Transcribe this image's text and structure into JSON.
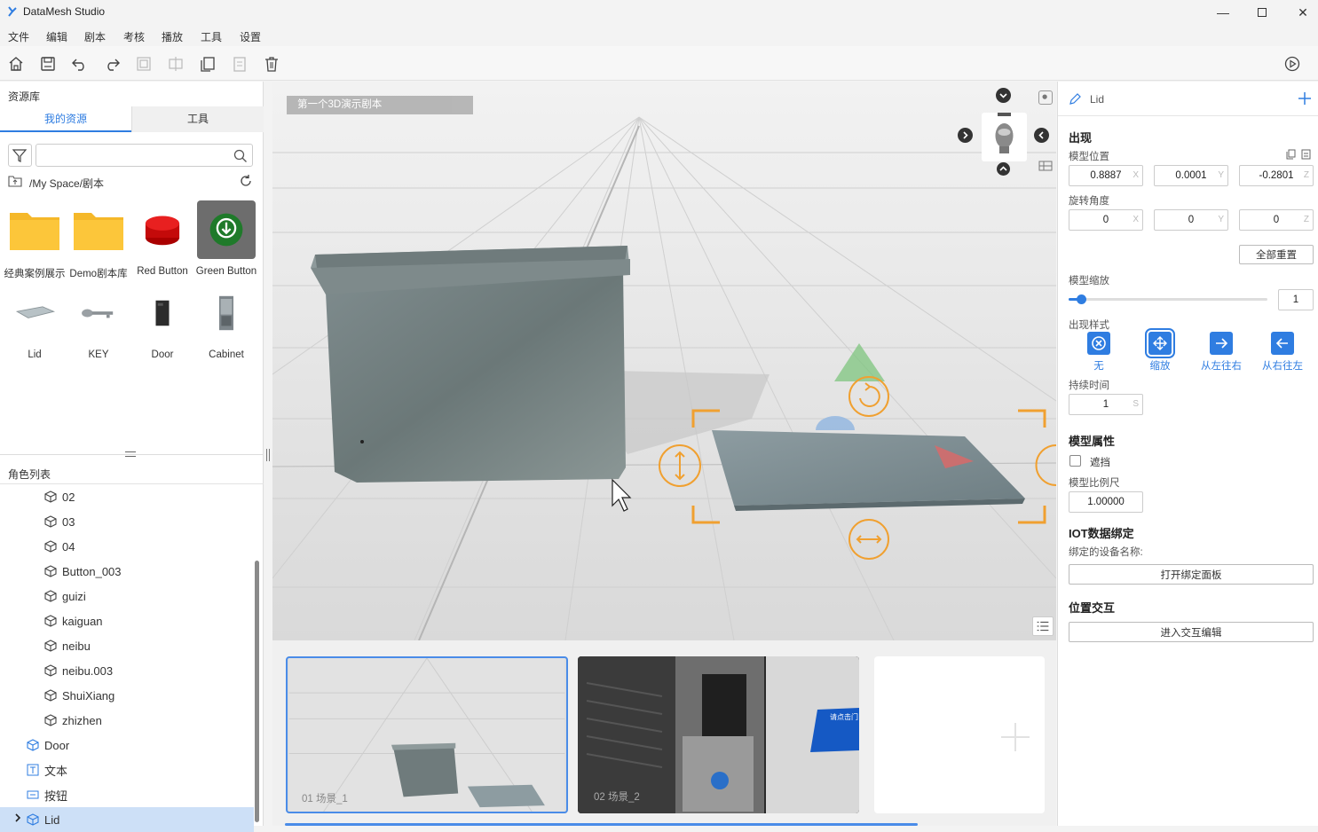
{
  "window": {
    "title": "DataMesh Studio"
  },
  "menu": [
    "文件",
    "编辑",
    "剧本",
    "考核",
    "播放",
    "工具",
    "设置"
  ],
  "left": {
    "library_title": "资源库",
    "tabs": [
      "我的资源",
      "工具"
    ],
    "path": "/My Space/剧本",
    "assets": [
      {
        "label": "经典案例展示",
        "icon": "folder-icon"
      },
      {
        "label": "Demo剧本库",
        "icon": "folder-icon"
      },
      {
        "label": "Red Button",
        "icon": "red-button-icon"
      },
      {
        "label": "Green Button",
        "icon": "green-button-icon"
      },
      {
        "label": "Lid",
        "icon": "lid-icon"
      },
      {
        "label": "KEY",
        "icon": "key-icon"
      },
      {
        "label": "Door",
        "icon": "door-icon"
      },
      {
        "label": "Cabinet",
        "icon": "cabinet-icon"
      }
    ],
    "roles_title": "角色列表",
    "tree": [
      {
        "label": "02",
        "icon": "cube-icon"
      },
      {
        "label": "03",
        "icon": "cube-icon"
      },
      {
        "label": "04",
        "icon": "cube-icon"
      },
      {
        "label": "Button_003",
        "icon": "cube-icon"
      },
      {
        "label": "guizi",
        "icon": "cube-icon"
      },
      {
        "label": "kaiguan",
        "icon": "cube-icon"
      },
      {
        "label": "neibu",
        "icon": "cube-icon"
      },
      {
        "label": "neibu.003",
        "icon": "cube-icon"
      },
      {
        "label": "ShuiXiang",
        "icon": "cube-icon"
      },
      {
        "label": "zhizhen",
        "icon": "cube-icon"
      },
      {
        "label": "Door",
        "icon": "cube-blue-icon"
      },
      {
        "label": "文本",
        "icon": "text-icon"
      },
      {
        "label": "按钮",
        "icon": "button-icon"
      },
      {
        "label": "Lid",
        "icon": "cube-blue-icon"
      }
    ]
  },
  "viewport": {
    "scene_title": "第一个3D演示剧本"
  },
  "scenes": [
    {
      "label": "01  场景_1"
    },
    {
      "label": "02  场景_2",
      "banner": "请点击门"
    }
  ],
  "right": {
    "object_name": "Lid",
    "appear_title": "出现",
    "position_label": "模型位置",
    "position": {
      "x": "0.8887",
      "y": "0.0001",
      "z": "-0.2801"
    },
    "rotation_label": "旋转角度",
    "rotation": {
      "x": "0",
      "y": "0",
      "z": "0"
    },
    "axes": [
      "X",
      "Y",
      "Z"
    ],
    "reset_label": "全部重置",
    "scale_label": "模型缩放",
    "scale_value": "1",
    "scale_slider_fraction": 0.04,
    "style_label": "出现样式",
    "styles": [
      "无",
      "缩放",
      "从左往右",
      "从右往左"
    ],
    "duration_label": "持续时间",
    "duration_value": "1",
    "duration_unit": "S",
    "props_title": "模型属性",
    "occlusion_label": "遮挡",
    "ratio_label": "模型比例尺",
    "ratio_value": "1.00000",
    "iot_title": "IOT数据绑定",
    "iot_device_label": "绑定的设备名称:",
    "iot_button": "打开绑定面板",
    "interact_title": "位置交互",
    "interact_button": "进入交互编辑"
  },
  "colors": {
    "accent": "#2f7de1",
    "gizmo": "#f0a030"
  }
}
